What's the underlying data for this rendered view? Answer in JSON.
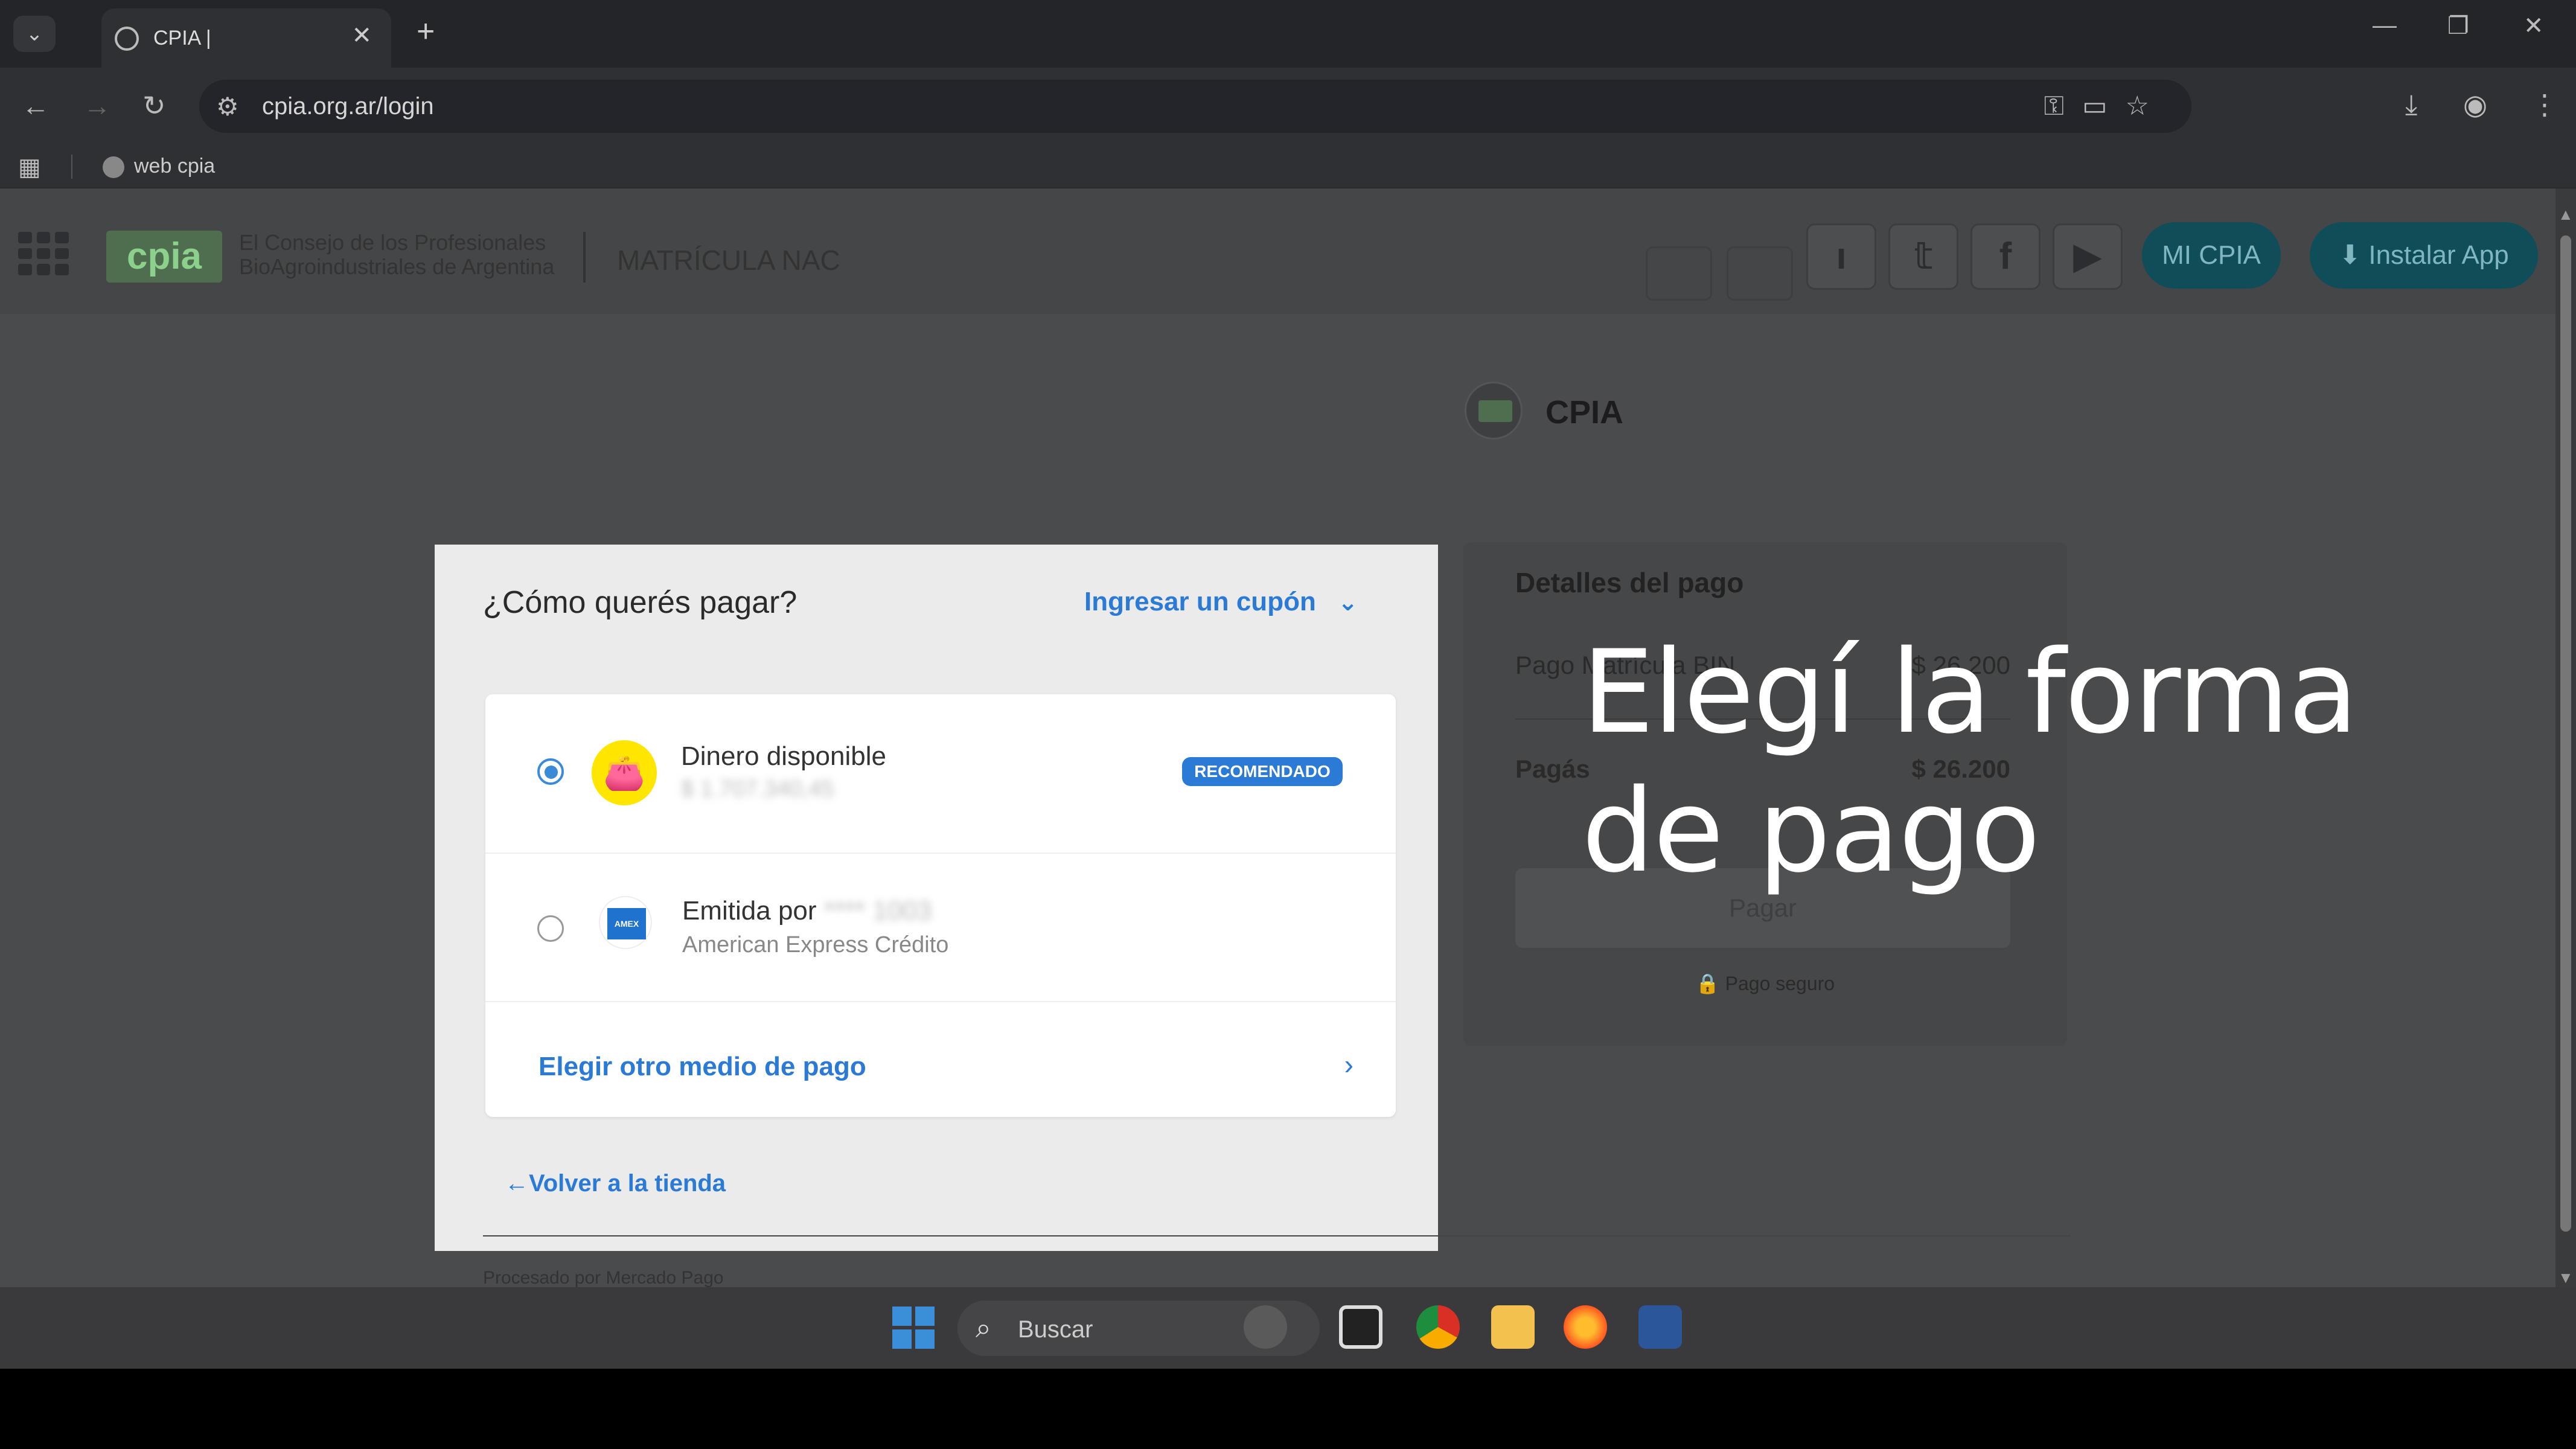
{
  "browser": {
    "tab_title": "CPIA |",
    "tab_close": "✕",
    "new_tab": "+",
    "url": "cpia.org.ar/login",
    "bookmark": "web cpia"
  },
  "site": {
    "logo_text": "cpia",
    "org_line1": "El Consejo de los Profesionales",
    "org_line2": "BioAgroindustriales de Argentina",
    "section": "MATRÍCULA NAC",
    "mi_cpia": "MI CPIA",
    "instalar": "⬇ Instalar App"
  },
  "modal": {
    "title": "¿Cómo querés pagar?",
    "coupon": "Ingresar un cupón",
    "option1_label": "Dinero disponible",
    "option1_sub": "$ 1.707.340,45",
    "option1_badge": "RECOMENDADO",
    "option2_label": "Emitida por",
    "option2_masked": "**** 1003",
    "option2_sub": "American Express Crédito",
    "option3_label": "Elegir otro medio de pago",
    "back": "←Volver a la tienda"
  },
  "summary": {
    "merchant": "CPIA",
    "heading": "Detalles del pago",
    "item_label": "Pago Matrícula BIN",
    "item_value": "$ 26.200",
    "total_label": "Pagás",
    "total_value": "$ 26.200",
    "pay_button": "Pagar",
    "secure": "🔒 Pago seguro"
  },
  "caption": {
    "line1": "Elegí la forma",
    "line2": "de pago"
  },
  "footer": {
    "text": "Procesado por Mercado Pago"
  },
  "taskbar": {
    "search": "Buscar"
  },
  "colors": {
    "accent": "#2b7bd6",
    "wallet": "#ffe600",
    "amex": "#1f72cd",
    "teal": "#0f4d59"
  }
}
